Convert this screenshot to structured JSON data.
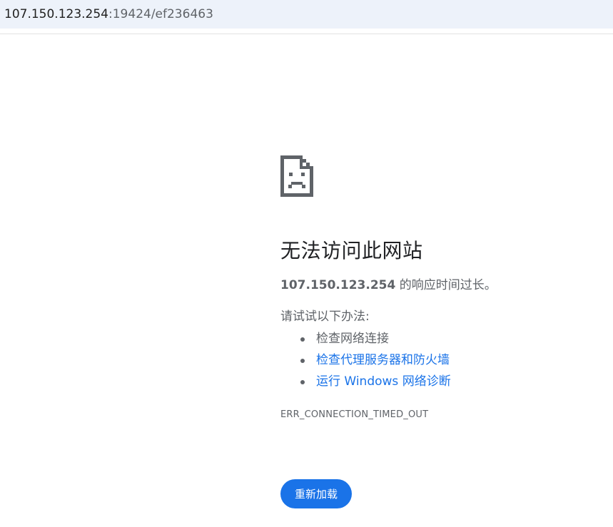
{
  "address_bar": {
    "host": "107.150.123.254",
    "rest": ":19424/ef236463"
  },
  "error_page": {
    "icon": "sad-document-icon",
    "headline": "无法访问此网站",
    "summary_host": "107.150.123.254",
    "summary_text": " 的响应时间过长。",
    "suggest_heading": "请试试以下办法:",
    "suggestions": [
      "检查网络连接",
      "检查代理服务器和防火墙",
      "运行 Windows 网络诊断"
    ],
    "error_code": "ERR_CONNECTION_TIMED_OUT",
    "reload_label": "重新加载"
  },
  "colors": {
    "accent": "#1a73e8",
    "address_bar_bg": "#edf2fa",
    "icon": "#5f6368"
  }
}
